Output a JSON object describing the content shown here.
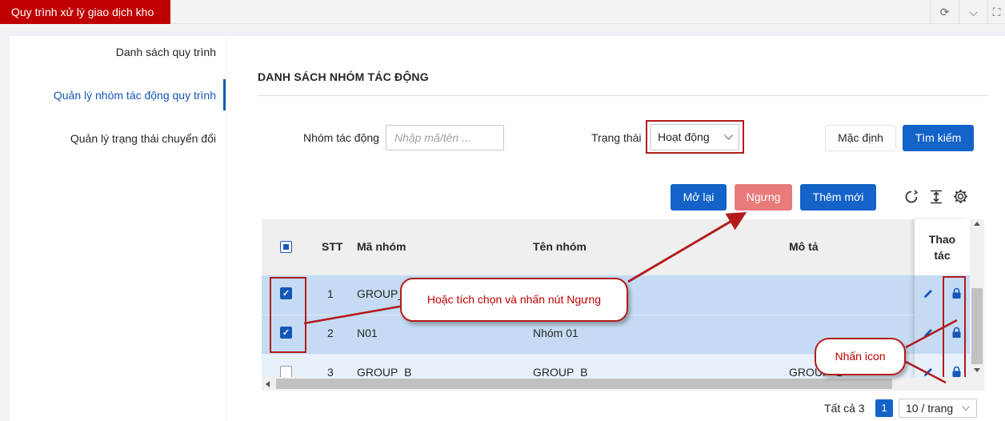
{
  "app": {
    "tab_title": "Quy trình xử lý giao dịch kho",
    "refresh_icon": "⟳",
    "chevron_icon": "⌵",
    "expand_icon": "⛶"
  },
  "sidebar": {
    "items": [
      {
        "label": "Danh sách quy trình",
        "active": false
      },
      {
        "label": "Quản lý nhóm tác động quy trình",
        "active": true
      },
      {
        "label": "Quản lý trạng thái chuyển đổi",
        "active": false
      }
    ]
  },
  "main": {
    "title": "DANH SÁCH NHÓM TÁC ĐỘNG"
  },
  "filters": {
    "group_label": "Nhóm tác động",
    "group_placeholder": "Nhập mã/tên ...",
    "group_value": "",
    "status_label": "Trạng thái",
    "status_value": "Hoạt động",
    "default_button": "Mặc định",
    "search_button": "Tìm kiếm"
  },
  "toolbar": {
    "reopen_button": "Mở lại",
    "stop_button": "Ngưng",
    "add_button": "Thêm mới"
  },
  "table": {
    "headers": {
      "stt": "STT",
      "code": "Mã nhóm",
      "name": "Tên nhóm",
      "desc": "Mô tả",
      "actions_1": "Thao",
      "actions_2": "tác"
    },
    "rows": [
      {
        "stt": "1",
        "code": "GROUP_",
        "name": "",
        "desc": "",
        "checked": true
      },
      {
        "stt": "2",
        "code": "N01",
        "name": "Nhóm 01",
        "desc": "",
        "checked": true
      },
      {
        "stt": "3",
        "code": "GROUP_B",
        "name": "GROUP_B",
        "desc": "GROUP_B",
        "checked": false
      }
    ]
  },
  "pagination": {
    "total": "Tất cả 3",
    "current_page": "1",
    "page_size": "10 / trang"
  },
  "annotations": {
    "callout_main": "Hoặc tích chọn và nhấn  nút Ngưng",
    "callout_icon": "Nhấn icon",
    "color": "#b31b1b"
  }
}
